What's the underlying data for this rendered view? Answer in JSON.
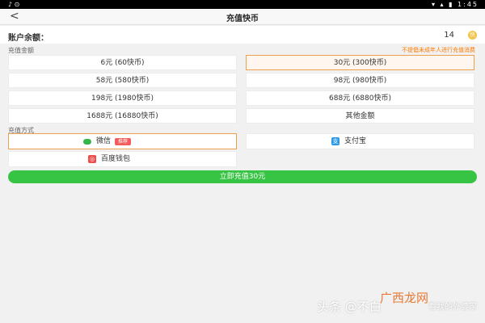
{
  "statusbar": {
    "left_icons": "♪  ⊙",
    "right_status": "▾ ▴ ▮ 1:45"
  },
  "navbar": {
    "back": "<",
    "title": "充值快币"
  },
  "balance": {
    "label": "账户余额：",
    "value": "14",
    "coin": "快"
  },
  "labels": {
    "amount_section": "充值金额",
    "notice": "不提倡未成年人进行充值消费",
    "pay_section": "充值方式"
  },
  "amounts": [
    "6元 (60快币)",
    "30元 (300快币)",
    "58元 (580快币)",
    "98元 (980快币)",
    "198元 (1980快币)",
    "688元 (6880快币)",
    "1688元 (16880快币)",
    "其他金额"
  ],
  "payments": {
    "wechat": "微信",
    "wechat_badge": "推荐",
    "alipay": "支付宝",
    "baidu": "百度钱包",
    "alipay_icon": "支",
    "baidu_icon": "◎"
  },
  "recharge_button": "立即充值30元",
  "watermark": {
    "left": "头条 @不白",
    "brand": "广西龙网",
    "right": "看我的外婆家"
  },
  "colors": {
    "accent_orange": "#f0a04d",
    "wechat_green": "#37c444",
    "notice_orange": "#ff7a00"
  }
}
